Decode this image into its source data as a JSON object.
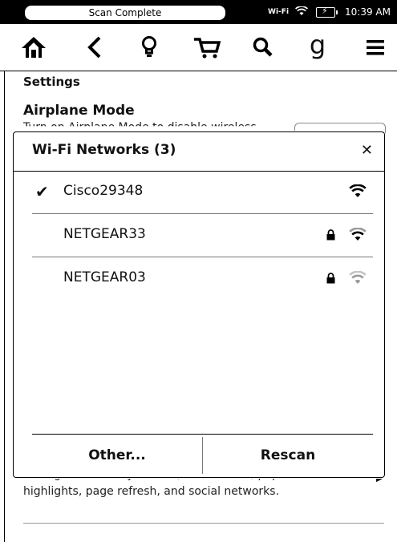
{
  "status_bar": {
    "message": "Scan Complete",
    "wifi_label": "Wi-Fi",
    "time": "10:39 AM"
  },
  "toolbar": {
    "icons": [
      "home-icon",
      "back-icon",
      "lightbulb-icon",
      "cart-icon",
      "search-icon",
      "goodreads-icon",
      "menu-icon"
    ],
    "goodreads_glyph": "g"
  },
  "settings": {
    "heading": "Settings",
    "airplane_title": "Airplane Mode",
    "airplane_desc": "Turn on Airplane Mode to disable wireless",
    "bottom_desc_line1": "Manage Vocabulary Builder, annotations, popular",
    "bottom_desc_line2": "highlights, page refresh, and social networks."
  },
  "dialog": {
    "title": "Wi-Fi Networks (3)",
    "close_glyph": "✕",
    "networks": [
      {
        "name": "Cisco29348",
        "connected": true,
        "locked": false,
        "signal": "strong"
      },
      {
        "name": "NETGEAR33",
        "connected": false,
        "locked": true,
        "signal": "strong"
      },
      {
        "name": "NETGEAR03",
        "connected": false,
        "locked": true,
        "signal": "weak"
      }
    ],
    "check_glyph": "✔",
    "other_label": "Other...",
    "rescan_label": "Rescan"
  },
  "colors": {
    "signal_strong": "#000000",
    "signal_weak": "#9a9a9a"
  }
}
